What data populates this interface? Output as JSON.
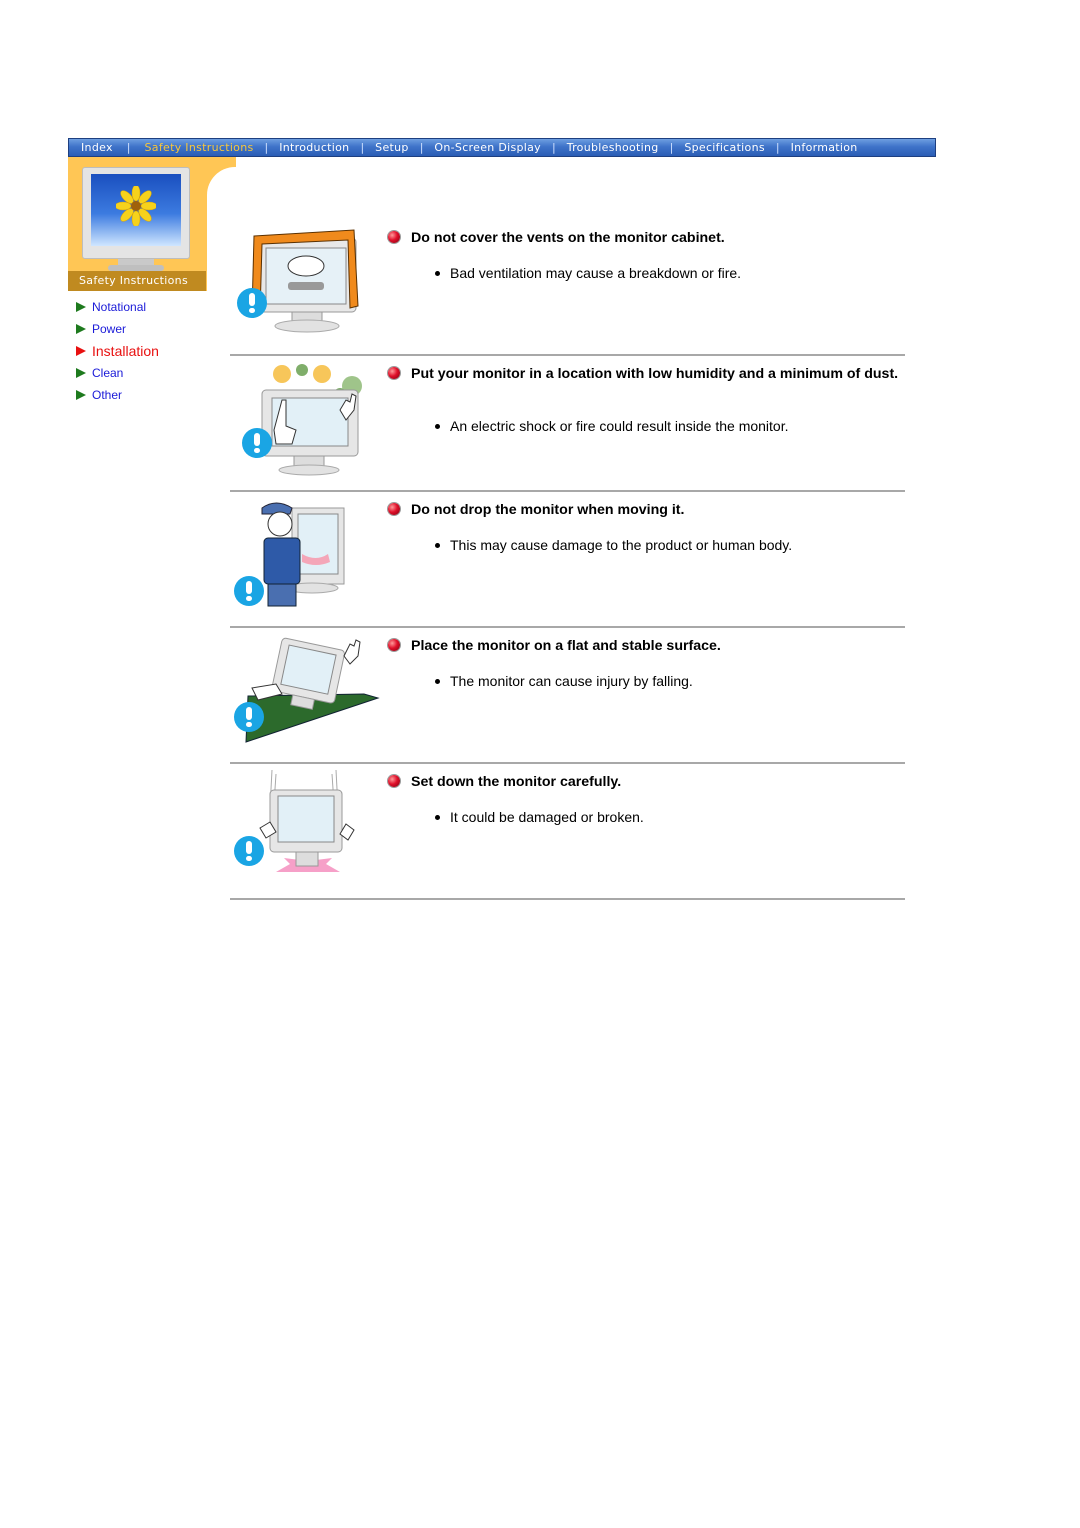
{
  "nav": {
    "items": [
      {
        "label": "Index",
        "active": false
      },
      {
        "label": "Safety Instructions",
        "active": true
      },
      {
        "label": "Introduction",
        "active": false
      },
      {
        "label": "Setup",
        "active": false
      },
      {
        "label": "On-Screen Display",
        "active": false
      },
      {
        "label": "Troubleshooting",
        "active": false
      },
      {
        "label": "Specifications",
        "active": false
      },
      {
        "label": "Information",
        "active": false
      }
    ],
    "separator": "|",
    "active_color": "#f7c63a",
    "bar_color": "#3f73c9"
  },
  "sidebar": {
    "section_title": "Safety Instructions",
    "image_icon": "monitor-with-sunflower",
    "items": [
      {
        "label": "Notational",
        "active": false
      },
      {
        "label": "Power",
        "active": false
      },
      {
        "label": "Installation",
        "active": true
      },
      {
        "label": "Clean",
        "active": false
      },
      {
        "label": "Other",
        "active": false
      }
    ],
    "link_color": "#1a1ad8",
    "active_color": "#e81010"
  },
  "content": {
    "items": [
      {
        "heading": "Do not cover the vents on the monitor cabinet.",
        "bullet": "Bad ventilation may cause a breakdown or fire.",
        "illustration": "monitor-covered-with-cloth-warning"
      },
      {
        "heading": "Put your monitor in a location with low humidity and a minimum of dust.",
        "bullet": "An electric shock or fire could result inside the monitor.",
        "illustration": "monitor-in-dust-warning"
      },
      {
        "heading": "Do not drop the monitor when moving it.",
        "bullet": "This may cause damage to the product or human body.",
        "illustration": "man-carrying-monitor-warning"
      },
      {
        "heading": "Place the monitor on a flat and stable surface.",
        "bullet": "The monitor can cause injury by falling.",
        "illustration": "monitor-on-slope-warning"
      },
      {
        "heading": "Set down the monitor carefully.",
        "bullet": "It could be damaged or broken.",
        "illustration": "monitor-set-down-warning"
      }
    ]
  }
}
